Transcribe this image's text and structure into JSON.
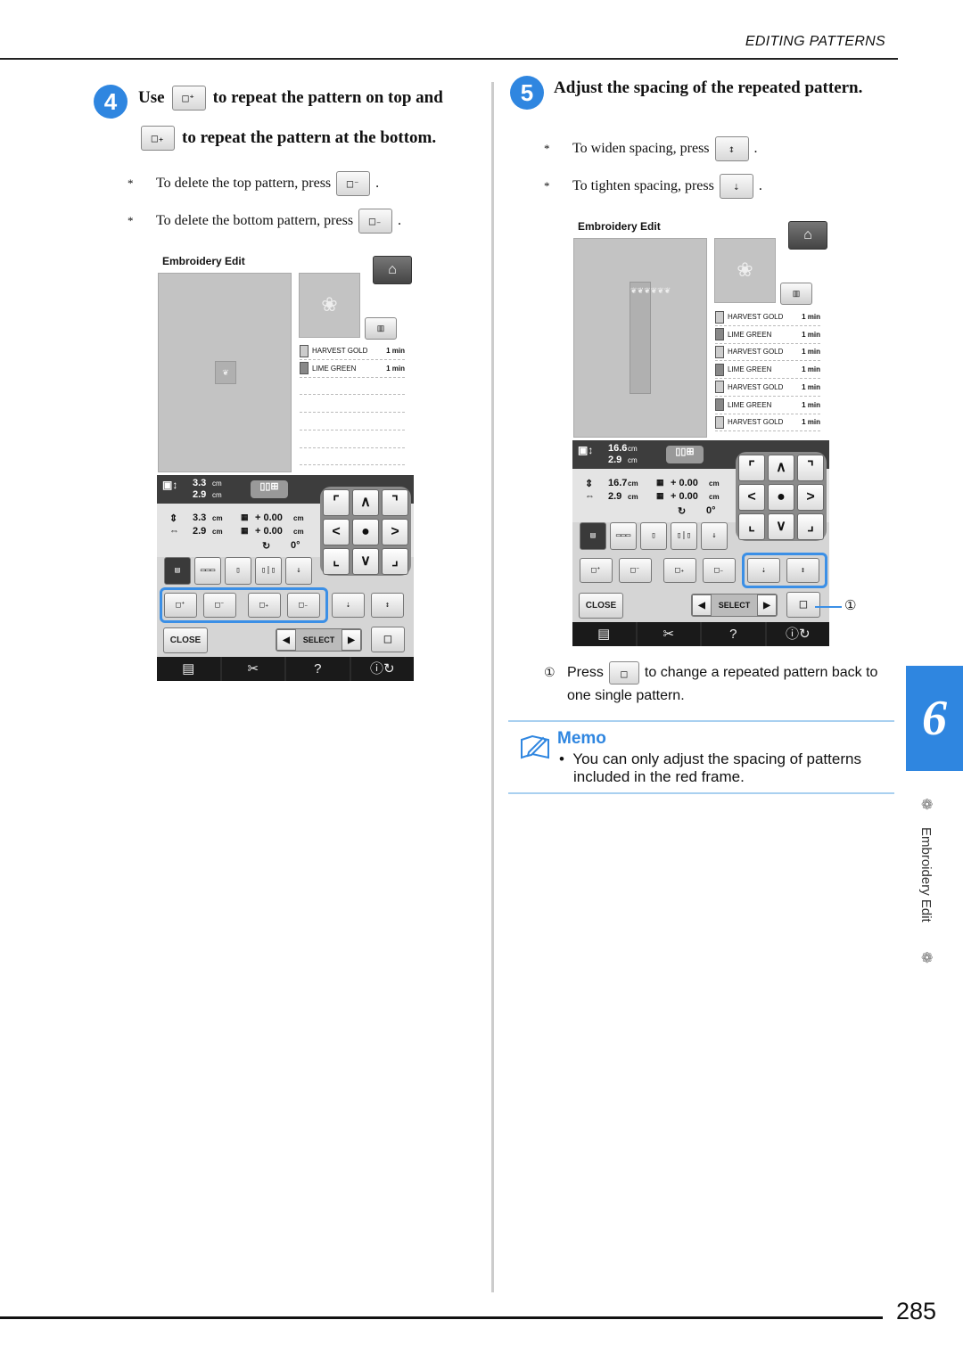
{
  "header": {
    "section": "EDITING PATTERNS"
  },
  "page_number": "285",
  "side_tab": {
    "chapter": "6",
    "label": "Embroidery Edit",
    "accent": "#2f86e0"
  },
  "step4": {
    "number": "4",
    "line1_a": "Use",
    "line1_b": "to repeat the pattern on top and",
    "line2": "to repeat the pattern at the bottom.",
    "notes": [
      {
        "bullet": "*",
        "text": "To delete the top pattern, press",
        "after": "."
      },
      {
        "bullet": "*",
        "text": "To delete the bottom pattern, press",
        "after": "."
      }
    ]
  },
  "step5": {
    "number": "5",
    "title": "Adjust the spacing of the repeated pattern.",
    "notes": [
      {
        "bullet": "*",
        "text": "To widen spacing, press",
        "after": "."
      },
      {
        "bullet": "*",
        "text": "To tighten spacing, press",
        "after": "."
      }
    ],
    "callout": {
      "marker": "①",
      "text_a": "Press",
      "text_b": "to change a repeated pattern back to",
      "text_c": "one single pattern."
    }
  },
  "memo": {
    "title": "Memo",
    "bullet": "•",
    "text": "You can only adjust the spacing of patterns included in the red frame."
  },
  "screens": [
    {
      "title": "Embroidery Edit",
      "threads": [
        {
          "name": "HARVEST GOLD",
          "time": "1",
          "unit": "min"
        },
        {
          "name": "LIME GREEN",
          "time": "1",
          "unit": "min"
        }
      ],
      "size_h": "3.3",
      "size_w": "2.9",
      "unit": "cm",
      "height": "3.3",
      "width": "2.9",
      "space_v": "+ 0.00",
      "space_h": "+ 0.00",
      "angle": "0°",
      "close": "CLOSE",
      "select": "SELECT",
      "highlight": "repeat",
      "repeated": false
    },
    {
      "title": "Embroidery Edit",
      "threads": [
        {
          "name": "HARVEST GOLD",
          "time": "1",
          "unit": "min"
        },
        {
          "name": "LIME GREEN",
          "time": "1",
          "unit": "min"
        },
        {
          "name": "HARVEST GOLD",
          "time": "1",
          "unit": "min"
        },
        {
          "name": "LIME GREEN",
          "time": "1",
          "unit": "min"
        },
        {
          "name": "HARVEST GOLD",
          "time": "1",
          "unit": "min"
        },
        {
          "name": "LIME GREEN",
          "time": "1",
          "unit": "min"
        },
        {
          "name": "HARVEST GOLD",
          "time": "1",
          "unit": "min"
        }
      ],
      "size_h": "16.6",
      "size_w": "2.9",
      "unit": "cm",
      "height": "16.7",
      "width": "2.9",
      "space_v": "+ 0.00",
      "space_h": "+ 0.00",
      "angle": "0°",
      "close": "CLOSE",
      "select": "SELECT",
      "highlight": "spacing",
      "repeated": true,
      "callout_marker": "①"
    }
  ]
}
